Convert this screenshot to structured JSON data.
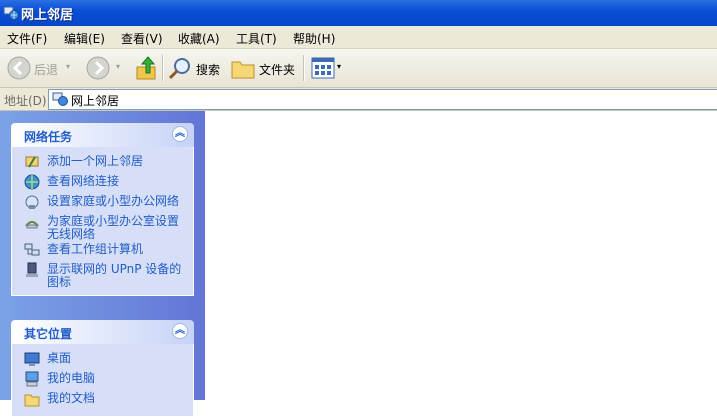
{
  "window": {
    "title": "网上邻居"
  },
  "menu": [
    {
      "label": "文件(F)"
    },
    {
      "label": "编辑(E)"
    },
    {
      "label": "查看(V)"
    },
    {
      "label": "收藏(A)"
    },
    {
      "label": "工具(T)"
    },
    {
      "label": "帮助(H)"
    }
  ],
  "toolbar": {
    "back_label": "后退",
    "search_label": "搜索",
    "folders_label": "文件夹"
  },
  "address": {
    "label": "地址(D)",
    "value": "网上邻居"
  },
  "network_tasks": {
    "title": "网络任务",
    "collapse_glyph": "︽",
    "items": [
      {
        "label": "添加一个网上邻居"
      },
      {
        "label": "查看网络连接"
      },
      {
        "label": "设置家庭或小型办公网络"
      },
      {
        "label": "为家庭或小型办公室设置无线网络"
      },
      {
        "label": "查看工作组计算机"
      },
      {
        "label": "显示联网的 UPnP 设备的图标"
      }
    ]
  },
  "other_places": {
    "title": "其它位置",
    "collapse_glyph": "︽",
    "items": [
      {
        "label": "桌面"
      },
      {
        "label": "我的电脑"
      },
      {
        "label": "我的文档"
      }
    ]
  }
}
